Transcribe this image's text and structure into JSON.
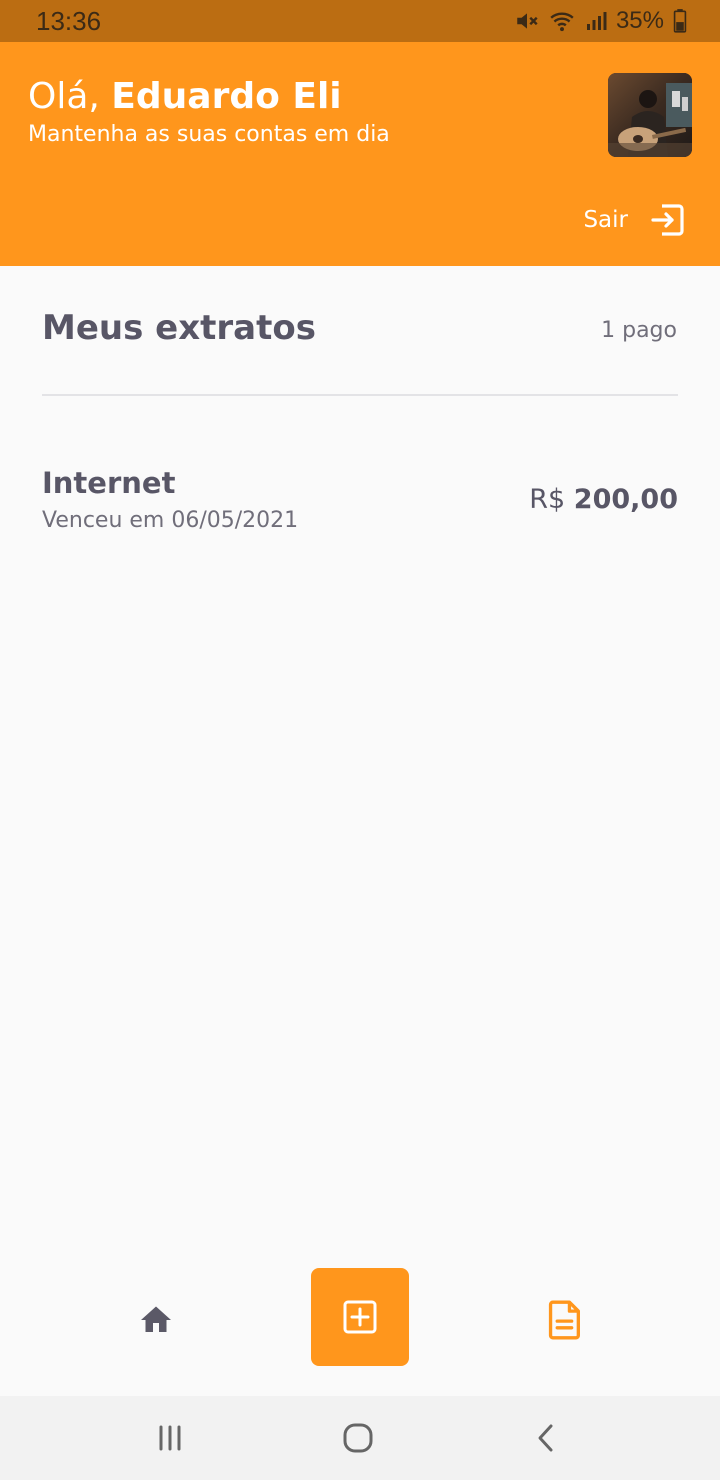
{
  "status_bar": {
    "time": "13:36",
    "battery": "35%",
    "icons": [
      "mute-icon",
      "wifi-icon",
      "signal-icon",
      "battery-icon"
    ]
  },
  "header": {
    "greeting_prefix": "Olá, ",
    "user_name": "Eduardo Eli",
    "subtitle": "Mantenha as suas contas em dia",
    "logout_label": "Sair",
    "logout_icon": "logout-icon",
    "avatar_icon": "avatar"
  },
  "content": {
    "title": "Meus extratos",
    "paid_count": "1 pago",
    "bills": [
      {
        "name": "Internet",
        "due_text": "Venceu em 06/05/2021",
        "currency": "R$",
        "amount": "200,00"
      }
    ]
  },
  "bottom_nav": {
    "items": [
      {
        "icon": "home-icon"
      },
      {
        "icon": "add-icon"
      },
      {
        "icon": "document-icon"
      }
    ]
  },
  "system_nav": {
    "items": [
      {
        "icon": "recent-apps-icon"
      },
      {
        "icon": "home-circle-icon"
      },
      {
        "icon": "back-icon"
      }
    ]
  },
  "colors": {
    "primary": "#FF961C",
    "status_bar": "#BB6D12",
    "heading": "#585666",
    "body_text": "#706E7A",
    "background": "#FAFAFA",
    "divider": "#E3E3E6"
  }
}
